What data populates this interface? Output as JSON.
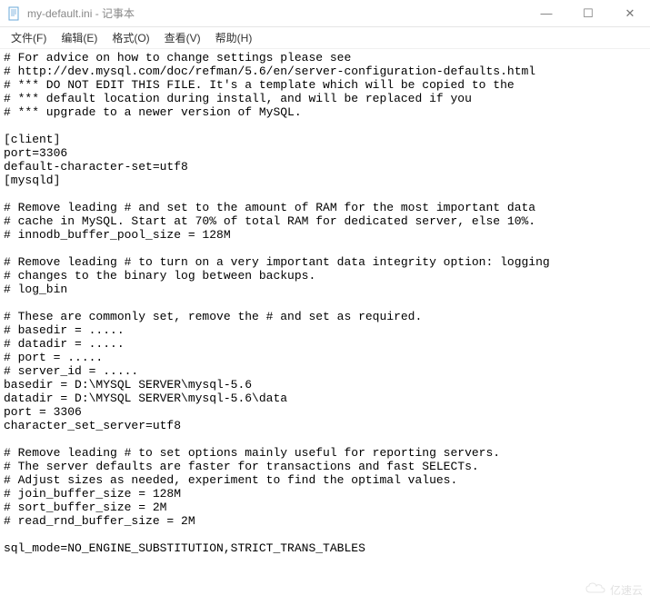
{
  "window": {
    "title": "my-default.ini - 记事本",
    "minimize": "—",
    "maximize": "☐",
    "close": "✕"
  },
  "menu": {
    "file": "文件(F)",
    "edit": "编辑(E)",
    "format": "格式(O)",
    "view": "查看(V)",
    "help": "帮助(H)"
  },
  "content": "# For advice on how to change settings please see\n# http://dev.mysql.com/doc/refman/5.6/en/server-configuration-defaults.html\n# *** DO NOT EDIT THIS FILE. It's a template which will be copied to the\n# *** default location during install, and will be replaced if you\n# *** upgrade to a newer version of MySQL.\n\n[client]\nport=3306\ndefault-character-set=utf8\n[mysqld]\n\n# Remove leading # and set to the amount of RAM for the most important data\n# cache in MySQL. Start at 70% of total RAM for dedicated server, else 10%.\n# innodb_buffer_pool_size = 128M\n\n# Remove leading # to turn on a very important data integrity option: logging\n# changes to the binary log between backups.\n# log_bin\n\n# These are commonly set, remove the # and set as required.\n# basedir = .....\n# datadir = .....\n# port = .....\n# server_id = .....\nbasedir = D:\\MYSQL SERVER\\mysql-5.6\ndatadir = D:\\MYSQL SERVER\\mysql-5.6\\data\nport = 3306\ncharacter_set_server=utf8\n\n# Remove leading # to set options mainly useful for reporting servers.\n# The server defaults are faster for transactions and fast SELECTs.\n# Adjust sizes as needed, experiment to find the optimal values.\n# join_buffer_size = 128M\n# sort_buffer_size = 2M\n# read_rnd_buffer_size = 2M\n\nsql_mode=NO_ENGINE_SUBSTITUTION,STRICT_TRANS_TABLES",
  "watermark": {
    "text": "亿速云"
  }
}
